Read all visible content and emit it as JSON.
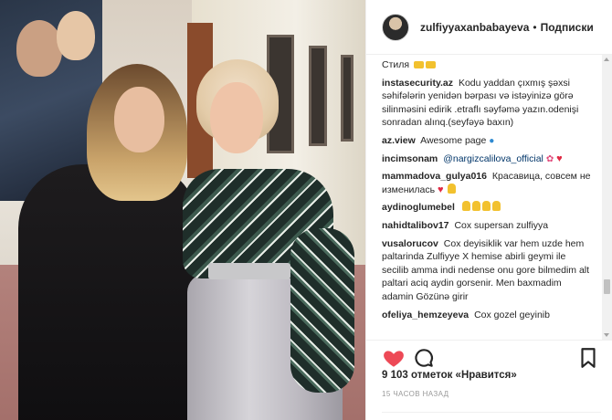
{
  "header": {
    "username": "zulfiyyaxanbabayeva",
    "separator": "•",
    "follow_label": "Подписки"
  },
  "comments": [
    {
      "user": "",
      "text": "Стиля"
    },
    {
      "user": "instasecurity.az",
      "text": "Kodu yaddan çıxmış şəxsi səhifələrin yenidən bərpası və istəyinizə görə silinməsini edirik .etraflı səyfəmə yazın.odenişi sonradan alınq.(seyfəyə baxın)"
    },
    {
      "user": "az.view",
      "text": "Awesome page"
    },
    {
      "user": "incimsonam",
      "mention": "@nargizcalilova_official",
      "text": ""
    },
    {
      "user": "mammadova_gulya016",
      "text": "Красавица, совсем не изменилась"
    },
    {
      "user": "aydinoglumebel",
      "text": ""
    },
    {
      "user": "nahidtalibov17",
      "text": "Cox supersan zulfiyya"
    },
    {
      "user": "vusalorucov",
      "text": "Cox deyisiklik var hem uzde hem paltarinda Zulfiyye X hemise abirli geymi ile secilib amma indi nedense onu gore bilmedim alt paltari aciq aydin gorsenir. Men baxmadim adamin Gözünə girir"
    },
    {
      "user": "ofeliya_hemzeyeva",
      "text": "Cox gozel geyinib"
    }
  ],
  "likes": {
    "count_text": "9 103 отметок «Нравится»"
  },
  "time_ago": "15 ЧАСОВ НАЗАД",
  "icons": {
    "like": "heart-icon",
    "comment": "comment-bubble-icon",
    "save": "bookmark-icon",
    "avatar": "avatar"
  },
  "colors": {
    "like_active": "#ed4956",
    "text": "#262626",
    "muted": "#999999",
    "mention": "#003569"
  }
}
